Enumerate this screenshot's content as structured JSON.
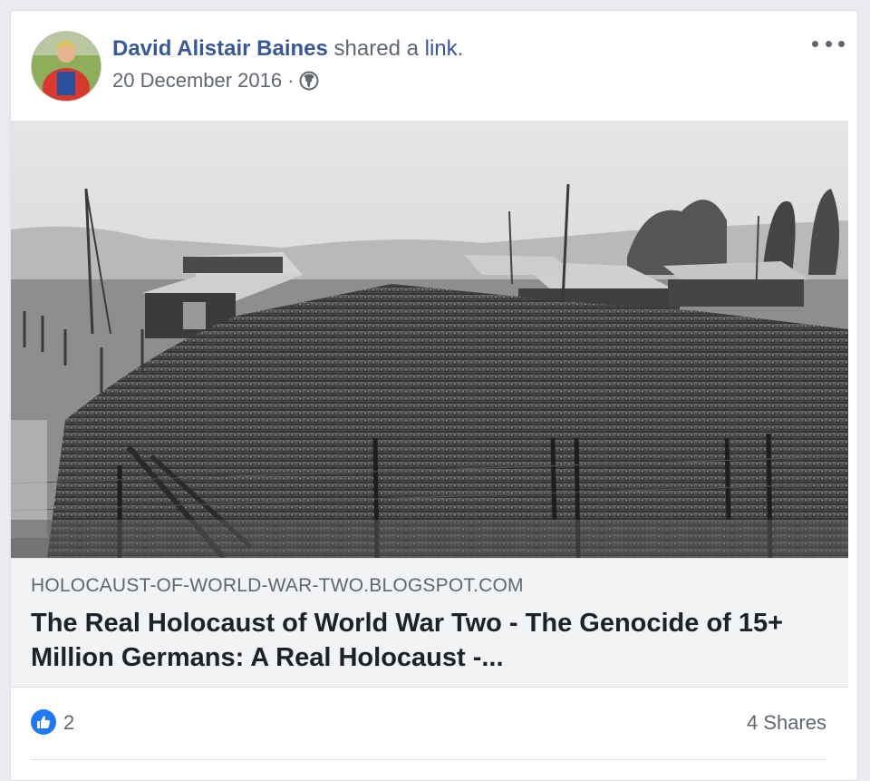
{
  "post": {
    "author": "David Alistair Baines",
    "action_text": " shared a ",
    "action_link": "link",
    "action_end": ".",
    "date": "20 December 2016",
    "separator": "·",
    "privacy_icon": "globe-icon",
    "more_icon": "more-options-icon"
  },
  "link_preview": {
    "domain": "HOLOCAUST-OF-WORLD-WAR-TWO.BLOGSPOT.COM",
    "title": "The Real Holocaust of World War Two - The Genocide of 15+ Million Germans: A Real Holocaust -...",
    "image": "black-and-white photo of a large crowd of soldiers in a fenced camp with wooden barracks"
  },
  "reactions": {
    "like_icon": "thumbs-up-icon",
    "like_count": "2",
    "shares": "4 Shares"
  },
  "colors": {
    "link_blue": "#385898",
    "meta_gray": "#606770",
    "like_blue": "#2078f4",
    "preview_bg": "#f2f3f5"
  }
}
